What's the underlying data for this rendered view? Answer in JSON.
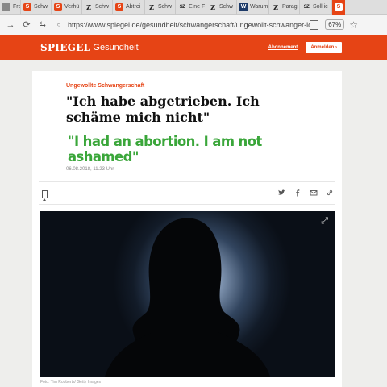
{
  "browser": {
    "tabs": [
      {
        "label": "Frau s",
        "icon": "generic-page-icon"
      },
      {
        "label": "Schw",
        "icon": "spiegel-icon"
      },
      {
        "label": "Verhü",
        "icon": "spiegel-icon"
      },
      {
        "label": "Schw",
        "icon": "zeit-icon"
      },
      {
        "label": "Abtrei",
        "icon": "spiegel-icon"
      },
      {
        "label": "Schw",
        "icon": "zeit-icon"
      },
      {
        "label": "Eine F",
        "icon": "sz-icon"
      },
      {
        "label": "Schw",
        "icon": "zeit-icon"
      },
      {
        "label": "Warum",
        "icon": "welt-icon"
      },
      {
        "label": "Parag",
        "icon": "zeit-icon"
      },
      {
        "label": "Soll ic",
        "icon": "sz-icon"
      }
    ],
    "active_tab_icon": "spiegel-icon",
    "url": "https://www.spiegel.de/gesundheit/schwangerschaft/ungewollt-schwanger-ich-habe",
    "zoom": "67%"
  },
  "site": {
    "logo": "SPIEGEL",
    "section": "Gesundheit",
    "subscribe_label": "Abonnement",
    "login_label": "Anmelden",
    "brand_color": "#e64415"
  },
  "article": {
    "kicker": "Ungewollte Schwangerschaft",
    "headline": "\"Ich habe abgetrieben. Ich schäme mich nicht\"",
    "subtitle_overlay": "\"I had an abortion. I am not ashamed\"",
    "subtitle_color": "#3aa63a",
    "date": "06.08.2018, 11.23 Uhr",
    "share_icons": [
      "twitter-icon",
      "facebook-icon",
      "mail-icon",
      "link-icon"
    ],
    "image_credit": "Foto: Tim Robberts/ Getty Images"
  }
}
